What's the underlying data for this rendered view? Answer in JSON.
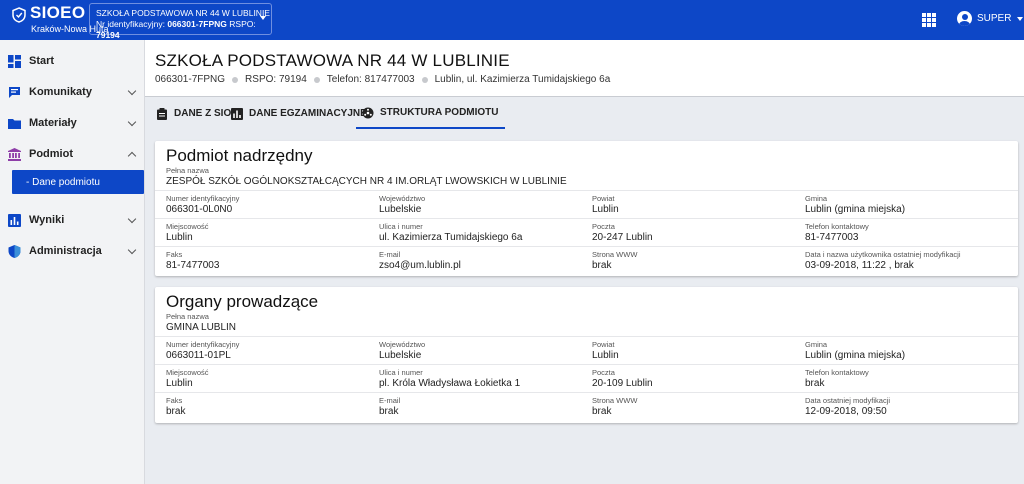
{
  "app": {
    "title": "SIOEO",
    "subtitle": "Kraków-Nowa Huta",
    "school_selector": {
      "line1": "SZKOŁA PODSTAWOWA NR 44 W LUBLINIE",
      "id_label": "Nr identyfikacyjny:",
      "id_value": "066301-7FPNG",
      "rspo_label": "RSPO:",
      "rspo_value": "79194"
    },
    "user": "SUPER",
    "primary_color": "#0d47c7"
  },
  "sidebar": {
    "items": [
      {
        "label": "Start",
        "icon": "dashboard-icon"
      },
      {
        "label": "Komunikaty",
        "icon": "message-icon"
      },
      {
        "label": "Materiały",
        "icon": "folder-icon"
      },
      {
        "label": "Podmiot",
        "icon": "institution-icon"
      },
      {
        "label": "Wyniki",
        "icon": "chart-icon"
      },
      {
        "label": "Administracja",
        "icon": "shield-icon"
      }
    ],
    "sub_items": [
      {
        "label": "- Dane podmiotu"
      }
    ]
  },
  "header": {
    "title": "SZKOŁA PODSTAWOWA NR 44 W LUBLINIE",
    "id": "066301-7FPNG",
    "rspo": "RSPO: 79194",
    "phone": "Telefon: 817477003",
    "address": "Lublin, ul. Kazimierza Tumidajskiego 6a"
  },
  "tabs": [
    {
      "label": "DANE Z SIO",
      "icon": "clipboard-icon"
    },
    {
      "label": "DANE EGZAMINACYJNE",
      "icon": "bar-chart-icon"
    },
    {
      "label": "STRUKTURA PODMIOTU",
      "icon": "hub-icon"
    }
  ],
  "parent": {
    "title": "Podmiot nadrzędny",
    "full_name_label": "Pełna nazwa",
    "full_name": "ZESPÓŁ SZKÓŁ OGÓLNOKSZTAŁCĄCYCH NR 4 IM.ORLĄT LWOWSKICH W LUBLINIE",
    "fields": [
      {
        "label": "Numer identyfikacyjny",
        "value": "066301-0L0N0"
      },
      {
        "label": "Województwo",
        "value": "Lubelskie"
      },
      {
        "label": "Powiat",
        "value": "Lublin"
      },
      {
        "label": "Gmina",
        "value": "Lublin (gmina miejska)"
      },
      {
        "label": "Miejscowość",
        "value": "Lublin"
      },
      {
        "label": "Ulica i numer",
        "value": "ul. Kazimierza Tumidajskiego 6a"
      },
      {
        "label": "Poczta",
        "value": "20-247 Lublin"
      },
      {
        "label": "Telefon kontaktowy",
        "value": "81-7477003"
      },
      {
        "label": "Faks",
        "value": "81-7477003"
      },
      {
        "label": "E-mail",
        "value": "zso4@um.lublin.pl"
      },
      {
        "label": "Strona WWW",
        "value": "brak"
      },
      {
        "label": "Data i nazwa użytkownika ostatniej modyfikacji",
        "value": "03-09-2018, 11:22 , brak"
      }
    ]
  },
  "governing": {
    "title": "Organy prowadzące",
    "full_name_label": "Pełna nazwa",
    "full_name": "GMINA LUBLIN",
    "fields": [
      {
        "label": "Numer identyfikacyjny",
        "value": "0663011-01PL"
      },
      {
        "label": "Województwo",
        "value": "Lubelskie"
      },
      {
        "label": "Powiat",
        "value": "Lublin"
      },
      {
        "label": "Gmina",
        "value": "Lublin (gmina miejska)"
      },
      {
        "label": "Miejscowość",
        "value": "Lublin"
      },
      {
        "label": "Ulica i numer",
        "value": "pl. Króla Władysława Łokietka 1"
      },
      {
        "label": "Poczta",
        "value": "20-109 Lublin"
      },
      {
        "label": "Telefon kontaktowy",
        "value": "brak"
      },
      {
        "label": "Faks",
        "value": "brak"
      },
      {
        "label": "E-mail",
        "value": "brak"
      },
      {
        "label": "Strona WWW",
        "value": "brak"
      },
      {
        "label": "Data ostatniej modyfikacji",
        "value": "12-09-2018, 09:50"
      }
    ]
  }
}
